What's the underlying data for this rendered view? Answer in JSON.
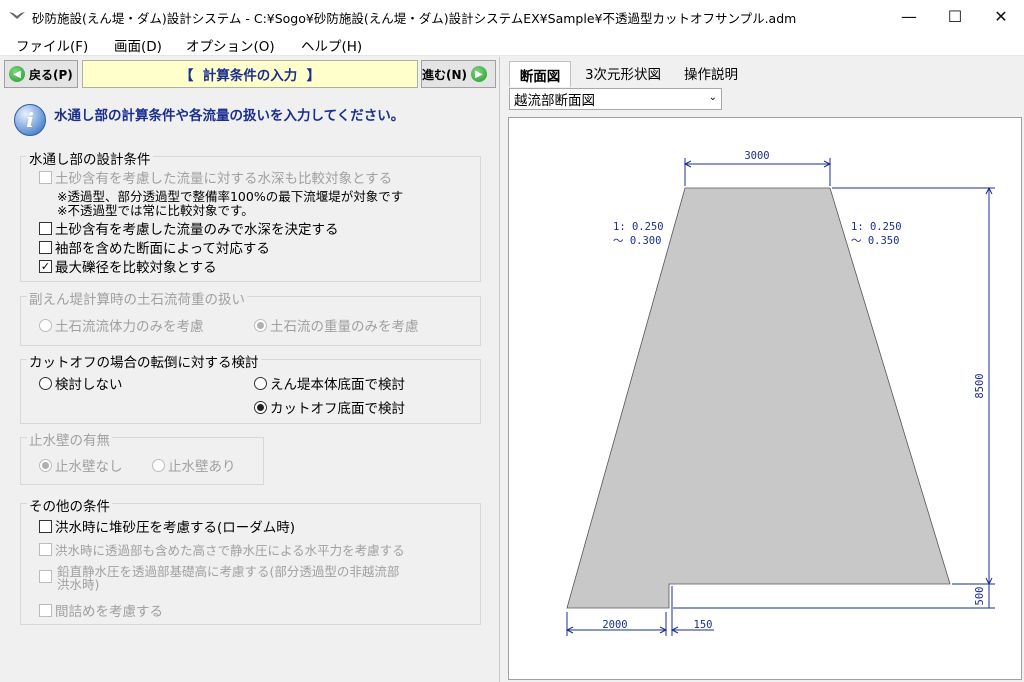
{
  "window": {
    "title": "砂防施設(えん堤・ダム)設計システム - C:¥Sogo¥砂防施設(えん堤・ダム)設計システムEX¥Sample¥不透過型カットオフサンプル.adm",
    "min_symbol": "—",
    "max_symbol": "☐",
    "close_symbol": "✕"
  },
  "menu": {
    "file": "ファイル(F)",
    "view": "画面(D)",
    "options": "オプション(O)",
    "help": "ヘルプ(H)"
  },
  "nav": {
    "back_label": "戻る(P)",
    "next_label": "進む(N)",
    "header": "【  計算条件の入力  】"
  },
  "info": {
    "icon_glyph": "i",
    "text": "水通し部の計算条件や各流量の扱いを入力してください。"
  },
  "groups": {
    "water_passage": {
      "legend": "水通し部の設計条件",
      "opt_sediment_compare": "土砂含有を考慮した流量に対する水深も比較対象とする",
      "note1": "※透過型、部分透過型で整備率100%の最下流堰堤が対象です",
      "note2": "※不透過型では常に比較対象です。",
      "opt_sediment_only": "土砂含有を考慮した流量のみで水深を決定する",
      "opt_sleeve": "袖部を含めた断面によって対応する",
      "opt_max_boulder": "最大礫径を比較対象とする",
      "check_mark": "✓"
    },
    "debris_load": {
      "legend": "副えん堤計算時の土石流荷重の扱い",
      "opt_fluid": "土石流流体力のみを考慮",
      "opt_weight": "土石流の重量のみを考慮"
    },
    "overturn": {
      "legend": "カットオフの場合の転倒に対する検討",
      "opt_none": "検討しない",
      "opt_body": "えん堤本体底面で検討",
      "opt_cutoff": "カットオフ底面で検討"
    },
    "cutoff_wall": {
      "legend": "止水壁の有無",
      "opt_none": "止水壁なし",
      "opt_exist": "止水壁あり"
    },
    "other": {
      "legend": "その他の条件",
      "opt_sediment_pressure": "洪水時に堆砂圧を考慮する(ローダム時)",
      "opt_hydrostatic": "洪水時に透過部も含めた高さで静水圧による水平力を考慮する",
      "opt_vertical_l1": "鉛直静水圧を透過部基礎高に考慮する(部分透過型の非越流部",
      "opt_vertical_l2": "洪水時)",
      "opt_gap": "間詰めを考慮する"
    }
  },
  "right": {
    "tabs": [
      "断面図",
      "3次元形状図",
      "操作説明"
    ],
    "section_select": "越流部断面図",
    "select_arrow": "⌄"
  },
  "drawing": {
    "crest_width": "3000",
    "height_main": "8500",
    "height_base": "500",
    "base_left": "2000",
    "base_cut": "150",
    "slope_left_l1": "1: 0.250",
    "slope_left_l2": "～ 0.300",
    "slope_right_l1": "1: 0.250",
    "slope_right_l2": "～ 0.350",
    "fill_color": "#c8c8c8",
    "dim_color": "#1b2f8f"
  }
}
